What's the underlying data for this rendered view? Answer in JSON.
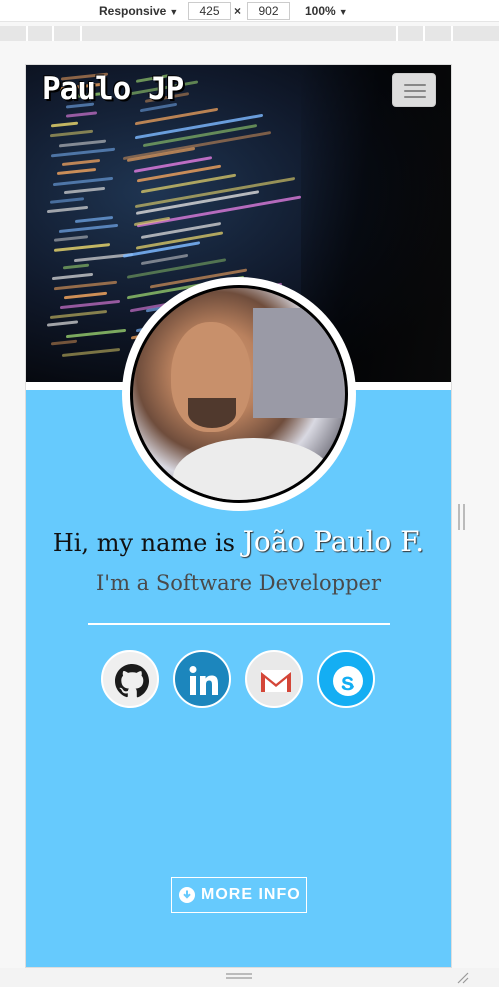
{
  "devtools": {
    "mode_label": "Responsive",
    "width_value": "425",
    "times_symbol": "×",
    "height_value": "902",
    "zoom_label": "100%"
  },
  "navbar": {
    "brand": "Paulo JP",
    "toggle_icon": "hamburger-icon"
  },
  "profile": {
    "greeting_prefix": "Hi, my name is ",
    "name": "João Paulo F.",
    "role": "I'm a Software Developper"
  },
  "social": [
    {
      "name": "github",
      "icon": "github-icon"
    },
    {
      "name": "linkedin",
      "icon": "linkedin-icon"
    },
    {
      "name": "gmail",
      "icon": "gmail-icon"
    },
    {
      "name": "skype",
      "icon": "skype-icon"
    }
  ],
  "cta": {
    "label": "MORE INFO",
    "icon": "arrow-circle-down-icon"
  },
  "colors": {
    "page_bg": "#66cafd",
    "linkedin": "#1c86bd",
    "skype": "#14aef3",
    "gmail_red": "#d44638"
  }
}
